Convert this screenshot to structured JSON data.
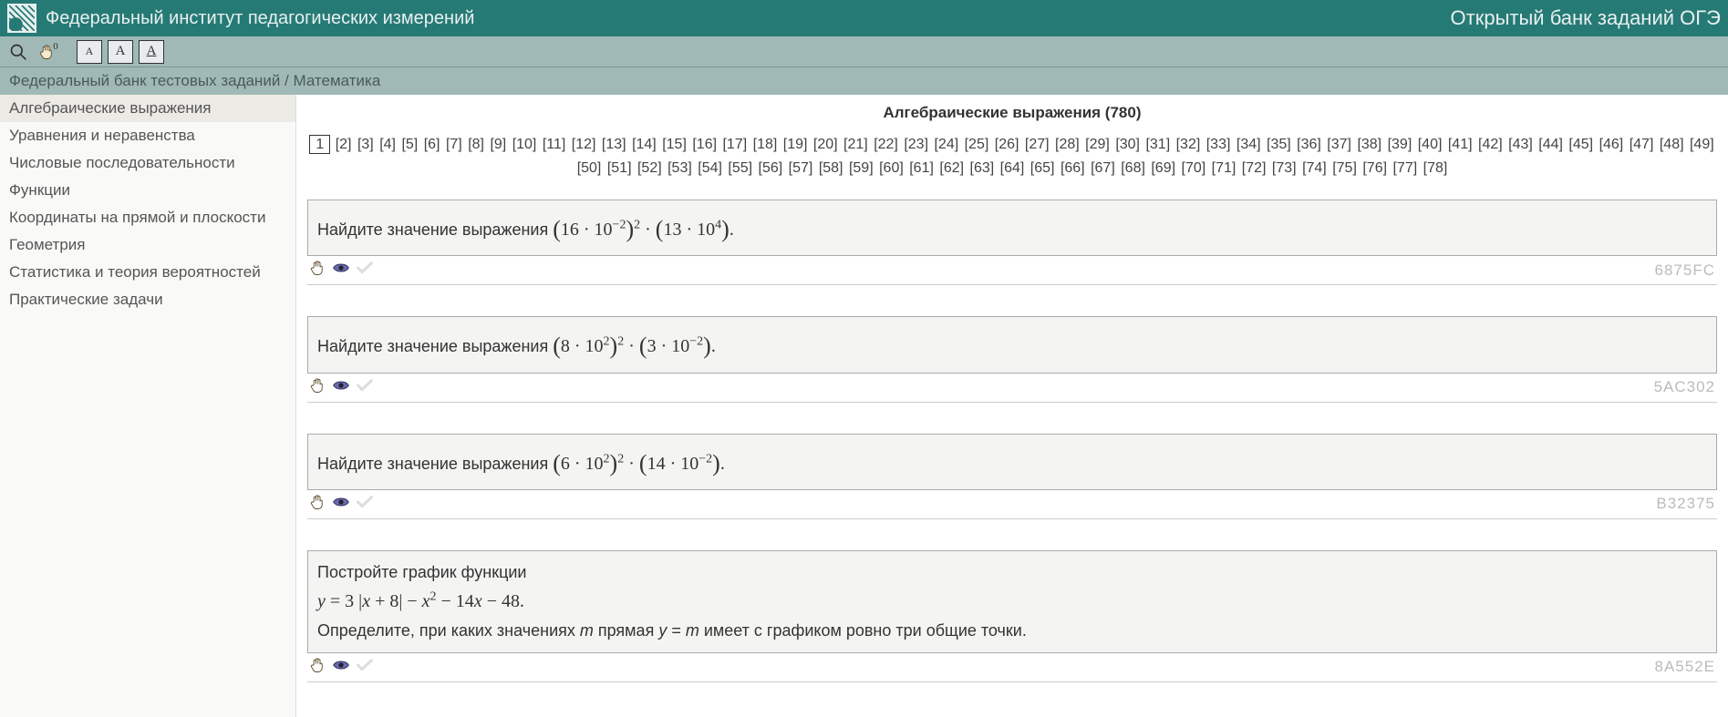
{
  "header": {
    "org_title": "Федеральный институт педагогических измерений",
    "right_title": "Открытый банк заданий ОГЭ"
  },
  "toolbar": {
    "hand_sup": "0",
    "font_a": "A",
    "font_b": "A",
    "font_c": "A"
  },
  "breadcrumb": "Федеральный банк тестовых заданий / Математика",
  "sidebar": {
    "items": [
      {
        "label": "Алгебраические выражения",
        "active": true
      },
      {
        "label": "Уравнения и неравенства",
        "active": false
      },
      {
        "label": "Числовые последовательности",
        "active": false
      },
      {
        "label": "Функции",
        "active": false
      },
      {
        "label": "Координаты на прямой и плоскости",
        "active": false
      },
      {
        "label": "Геометрия",
        "active": false
      },
      {
        "label": "Статистика и теория вероятностей",
        "active": false
      },
      {
        "label": "Практические задачи",
        "active": false
      }
    ]
  },
  "main": {
    "title": "Алгебраические выражения (780)",
    "pager": {
      "current": 1,
      "total": 78
    }
  },
  "tasks": [
    {
      "prefix": "Найдите значение выражения ",
      "math_html": "<span class='br-open'>(</span>16 · 10<sup>−2</sup><span class='br-close'>)</span><sup>2</sup> · <span class='br-open'>(</span>13 · 10<sup>4</sup><span class='br-close'>)</span>.",
      "suffix": "",
      "code": "6875FC"
    },
    {
      "prefix": "Найдите значение выражения ",
      "math_html": "<span class='br-open'>(</span>8 · 10<sup>2</sup><span class='br-close'>)</span><sup>2</sup> · <span class='br-open'>(</span>3 · 10<sup>−2</sup><span class='br-close'>)</span>.",
      "suffix": "",
      "code": "5AC302"
    },
    {
      "prefix": "Найдите значение выражения ",
      "math_html": "<span class='br-open'>(</span>6 · 10<sup>2</sup><span class='br-close'>)</span><sup>2</sup> · <span class='br-open'>(</span>14 · 10<sup>−2</sup><span class='br-close'>)</span>.",
      "suffix": "",
      "code": "B32375"
    },
    {
      "prefix": "Постройте график функции",
      "math_html": "<div><span class='italic'>y</span> = 3 |<span class='italic'>x</span> + 8| − <span class='italic'>x</span><sup>2</sup> − 14<span class='italic'>x</span> − 48.</div>",
      "suffix": "Определите, при каких значениях <span class='italic'>m</span> прямая <span class='italic'>y</span> = <span class='italic'>m</span> имеет с графиком ровно три общие точки.",
      "multiline": true,
      "code": "8A552E"
    }
  ]
}
